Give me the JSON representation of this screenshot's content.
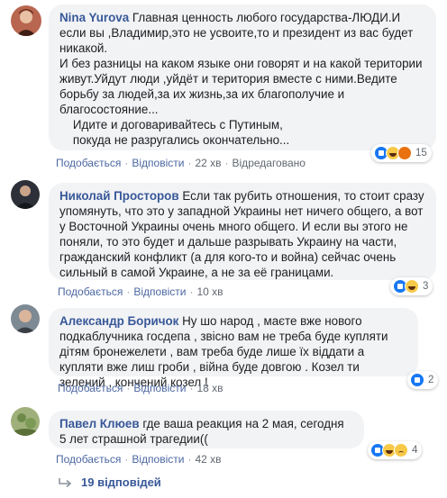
{
  "comments": [
    {
      "author": "Nina Yurova",
      "text": " Главная ценность любого государства-ЛЮДИ.И если вы ,Владимир,это не усвоите,то и президент из вас будет никакой.\nИ без разницы на каком языке они говорят и на какой територии живут.Уйдут люди ,уйдёт и територия вместе с ними.Ведите борьбу за людей,за их жизнь,за их благополучие и благосостояние...\n    Идите и договаривайтесь с Путиным,\n    покуда не разругались окончательно...",
      "actions": {
        "like": "Подобається",
        "reply": "Відповісти",
        "time": "22 хв",
        "edited": "Відредаговано"
      },
      "reactions": {
        "icons": [
          "like-icon",
          "haha-icon",
          "angry-icon"
        ],
        "count": "15"
      }
    },
    {
      "author": "Николай Просторов",
      "text": " Если так рубить отношения, то стоит сразу упомянуть, что это у западной Украины нет ничего общего, а вот у Восточной Украины очень много общего. И если вы этого не поняли, то это будет и дальше разрывать Украину на части, гражданский конфликт (а для кого-то и война) сейчас очень сильный в самой Украине, а не за её границами.",
      "actions": {
        "like": "Подобається",
        "reply": "Відповісти",
        "time": "10 хв"
      },
      "reactions": {
        "icons": [
          "like-icon",
          "haha-icon"
        ],
        "count": "3"
      }
    },
    {
      "author": "Александр Боричок",
      "text": " Ну шо народ , маєте вже нового подкаблучника госдепа , звісно вам не треба буде купляти дітям бронежелети , вам треба буде лише їх віддати а купляти вже лиш гроби , війна буде довгою . Козел ти зелений , кончений козел !",
      "actions": {
        "like": "Подобається",
        "reply": "Відповісти",
        "time": "18 хв"
      },
      "reactions": {
        "icons": [
          "like-icon"
        ],
        "count": "2"
      }
    },
    {
      "author": "Павел Клюев",
      "text": " где ваша реакция на 2 мая, сегодня 5 лет страшной трагедии((",
      "actions": {
        "like": "Подобається",
        "reply": "Відповісти",
        "time": "42 хв"
      },
      "reactions": {
        "icons": [
          "like-icon",
          "haha-icon",
          "sad-icon"
        ],
        "count": "4"
      }
    }
  ],
  "replies_label": "19 відповідей",
  "colors": {
    "author": "#385898",
    "bubble": "#f2f3f5",
    "meta": "#606770",
    "link": "#4b67a1"
  }
}
